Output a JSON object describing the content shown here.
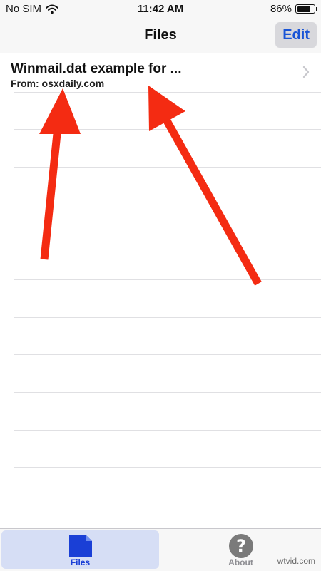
{
  "status_bar": {
    "carrier": "No SIM",
    "wifi_icon": "wifi-icon",
    "time": "11:42 AM",
    "battery_percent": "86%",
    "battery_level": 0.86
  },
  "nav": {
    "title": "Files",
    "edit_label": "Edit"
  },
  "files": [
    {
      "title": "Winmail.dat example for ...",
      "subtitle": "From: osxdaily.com"
    }
  ],
  "tabs": [
    {
      "label": "Files",
      "icon": "document-icon",
      "selected": true
    },
    {
      "label": "About",
      "icon": "question-icon",
      "selected": false
    }
  ],
  "watermark": "wtvid.com",
  "colors": {
    "accent": "#1a55d6",
    "tab_selected_bg": "#d6def5",
    "arrow": "#f42b12"
  }
}
